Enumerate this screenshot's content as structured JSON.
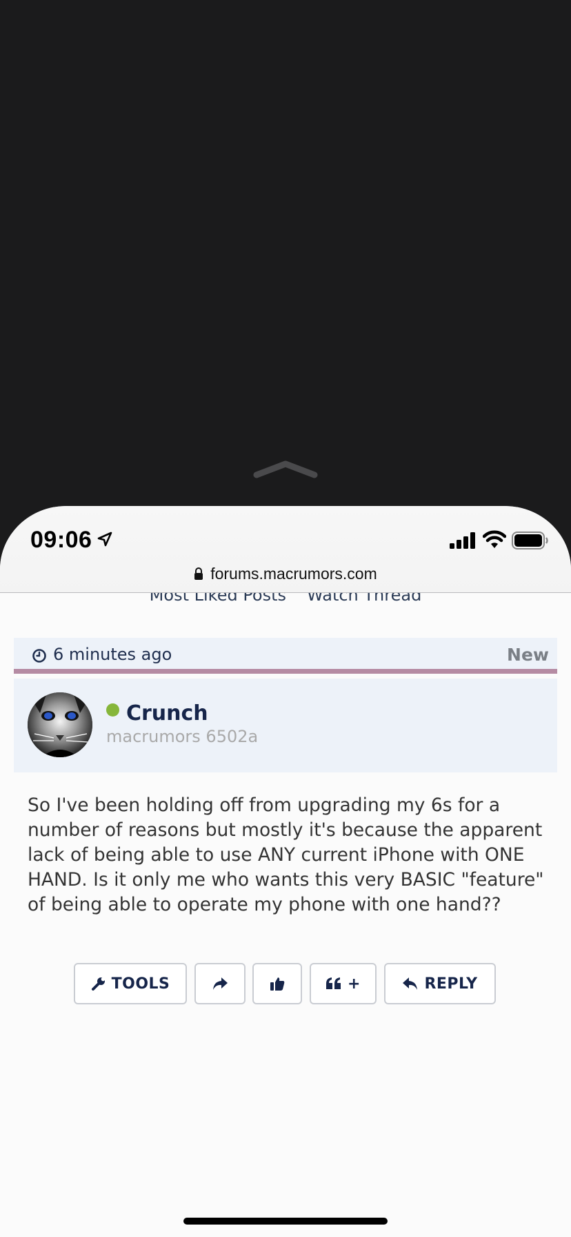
{
  "status": {
    "time": "09:06",
    "url": "forums.macrumors.com"
  },
  "thread_links": {
    "most_liked": "Most Liked Posts",
    "watch": "Watch Thread"
  },
  "post": {
    "time_ago": "6 minutes ago",
    "badge": "New",
    "author": {
      "name": "Crunch",
      "title": "macrumors 6502a",
      "online": true
    },
    "body": "So I've been holding off from upgrading my 6s for a number of reasons but mostly it's because the apparent lack of being able to use ANY current iPhone with ONE HAND. Is it only me who wants this very BASIC \"feature\" of being able to operate my phone with one hand??",
    "actions": {
      "tools": "TOOLS",
      "quote_plus": "+",
      "reply": "REPLY"
    }
  },
  "colors": {
    "accent_navy": "#16254a",
    "meta_bg": "#edf2f9",
    "meta_border": "#b58ba3",
    "online": "#86b63a"
  },
  "icons": [
    "location-arrow-icon",
    "signal-icon",
    "wifi-icon",
    "battery-icon",
    "lock-icon",
    "clock-icon",
    "wrench-icon",
    "share-icon",
    "thumbs-up-icon",
    "quote-icon",
    "reply-icon",
    "chevron-up-icon"
  ]
}
